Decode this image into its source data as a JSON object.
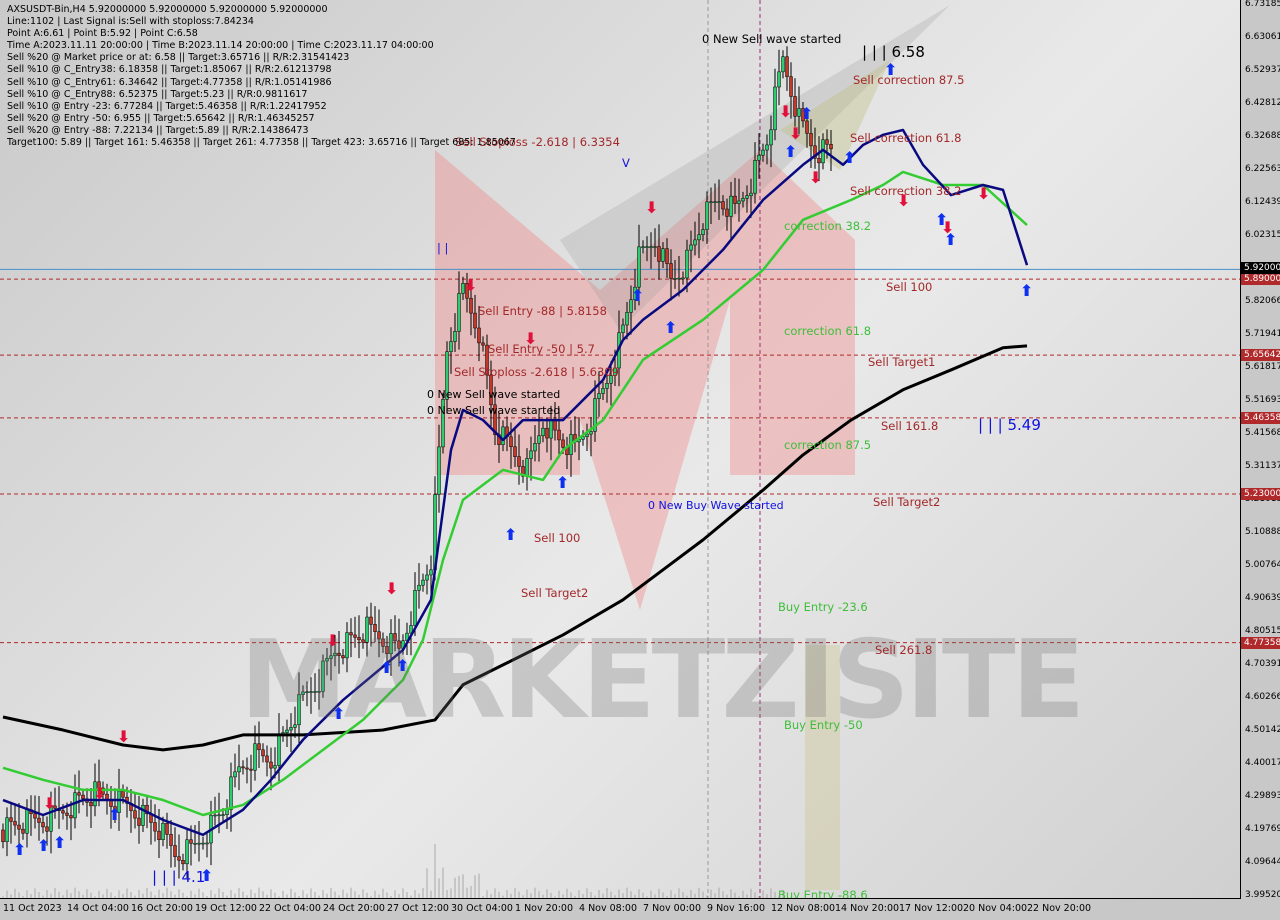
{
  "header": {
    "symbol_line": "AXSUSDT-Bin,H4  5.92000000 5.92000000 5.92000000 5.92000000",
    "lines": [
      "Line:1102 | Last Signal is:Sell with stoploss:7.84234",
      "Point A:6.61 | Point B:5.92 | Point C:6.58",
      "Time A:2023.11.11 20:00:00 | Time B:2023.11.14 20:00:00 | Time C:2023.11.17 04:00:00",
      "Sell %20 @ Market price or at: 6.58 || Target:3.65716 || R/R:2.31541423",
      "Sell %10 @ C_Entry38: 6.18358 || Target:1.85067 || R/R:2.61213798",
      "Sell %10 @ C_Entry61: 6.34642 || Target:4.77358 || R/R:1.05141986",
      "Sell %10 @ C_Entry88: 6.52375 || Target:5.23 || R/R:0.9811617",
      "Sell %10 @ Entry -23: 6.77284 || Target:5.46358 || R/R:1.22417952",
      "Sell %20 @ Entry -50: 6.955 || Target:5.65642 || R/R:1.46345257",
      "Sell %20 @ Entry -88: 7.22134 || Target:5.89 || R/R:2.14386473",
      "Target100: 5.89 || Target 161: 5.46358 || Target 261: 4.77358 || Target 423: 3.65716 || Target 685: 1.85067"
    ]
  },
  "watermark": "MARKETZISITE",
  "annotations": [
    "0 New Sell wave started",
    "| | | 6.58",
    "Sell correction 87.5",
    "Sell correction 61.8",
    "Sell correction 38.2",
    "correction 38.2",
    "Sell Stoploss -2.618 | 6.3354",
    "Sell Entry -88 | 5.8158",
    "Sell Entry -50 | 5.7",
    "Sell Stoploss -2.618 | 5.6309",
    "0 New Sell wave started",
    "0 New Sell wave started",
    "Sell 100",
    "correction 61.8",
    "Sell Target1",
    "Sell 161.8",
    "| | | 5.49",
    "correction 87.5",
    "0 New Buy Wave started",
    "Sell Target2",
    "Sell 100",
    "Sell Target2",
    "Buy Entry -23.6",
    "Sell 261.8",
    "Buy Entry -50",
    "| | | 4.1",
    "Buy Entry -88.6",
    "| |",
    "V"
  ],
  "chart_data": {
    "type": "candlestick",
    "timeframe": "H4",
    "ylim": [
      3.9952,
      6.73185
    ],
    "y_ticks": [
      "6.73185",
      "6.63061",
      "6.52937",
      "6.42812",
      "6.32688",
      "6.22563",
      "6.12439",
      "6.02315",
      "5.82066",
      "5.71941",
      "5.61817",
      "5.51693",
      "5.41568",
      "5.31137",
      "5.21013",
      "5.10888",
      "5.00764",
      "4.90639",
      "4.80515",
      "4.70391",
      "4.60266",
      "4.50142",
      "4.40017",
      "4.29893",
      "4.19769",
      "4.09644",
      "3.99520"
    ],
    "x_ticks": [
      "11 Oct 2023",
      "14 Oct 04:00",
      "16 Oct 20:00",
      "19 Oct 12:00",
      "22 Oct 04:00",
      "24 Oct 20:00",
      "27 Oct 12:00",
      "30 Oct 04:00",
      "1 Nov 20:00",
      "4 Nov 08:00",
      "7 Nov 00:00",
      "9 Nov 16:00",
      "12 Nov 08:00",
      "14 Nov 20:00",
      "17 Nov 12:00",
      "20 Nov 04:00",
      "22 Nov 20:00"
    ],
    "current_price": "5.92000",
    "levels": [
      {
        "label": "5.89000",
        "value": 5.89
      },
      {
        "label": "5.65642",
        "value": 5.65642
      },
      {
        "label": "5.46358",
        "value": 5.46358
      },
      {
        "label": "5.23000",
        "value": 5.23
      },
      {
        "label": "4.77358",
        "value": 4.77358
      }
    ],
    "closes_every_4_bars": [
      4.198,
      4.213,
      4.223,
      4.229,
      4.26,
      4.29,
      4.306,
      4.29,
      4.275,
      4.244,
      4.198,
      4.121,
      4.137,
      4.198,
      4.26,
      4.382,
      4.428,
      4.413,
      4.505,
      4.597,
      4.659,
      4.751,
      4.782,
      4.812,
      4.782,
      4.751,
      4.904,
      5.027,
      5.672,
      5.857,
      5.734,
      5.427,
      5.365,
      5.304,
      5.457,
      5.396,
      5.365,
      5.457,
      5.58,
      5.734,
      5.949,
      6.01,
      5.887,
      5.949,
      6.072,
      6.133,
      6.102,
      6.194,
      6.317,
      6.563,
      6.379,
      6.286,
      6.29
    ],
    "ma_slow": [
      [
        0,
        4.545
      ],
      [
        15,
        4.505
      ],
      [
        30,
        4.459
      ],
      [
        40,
        4.444
      ],
      [
        50,
        4.459
      ],
      [
        60,
        4.49
      ],
      [
        75,
        4.49
      ],
      [
        95,
        4.505
      ],
      [
        108,
        4.536
      ],
      [
        115,
        4.644
      ],
      [
        125,
        4.705
      ],
      [
        140,
        4.797
      ],
      [
        155,
        4.905
      ],
      [
        165,
        4.997
      ],
      [
        175,
        5.089
      ],
      [
        190,
        5.242
      ],
      [
        200,
        5.35
      ],
      [
        212,
        5.457
      ],
      [
        225,
        5.55
      ],
      [
        237,
        5.611
      ],
      [
        250,
        5.679
      ],
      [
        256,
        5.685
      ]
    ],
    "ma_mid": [
      [
        0,
        4.389
      ],
      [
        10,
        4.352
      ],
      [
        20,
        4.321
      ],
      [
        30,
        4.321
      ],
      [
        40,
        4.29
      ],
      [
        50,
        4.244
      ],
      [
        60,
        4.275
      ],
      [
        70,
        4.352
      ],
      [
        80,
        4.444
      ],
      [
        90,
        4.536
      ],
      [
        100,
        4.659
      ],
      [
        105,
        4.782
      ],
      [
        110,
        5.027
      ],
      [
        115,
        5.212
      ],
      [
        125,
        5.304
      ],
      [
        135,
        5.273
      ],
      [
        140,
        5.365
      ],
      [
        150,
        5.457
      ],
      [
        160,
        5.642
      ],
      [
        175,
        5.765
      ],
      [
        190,
        5.918
      ],
      [
        200,
        6.072
      ],
      [
        212,
        6.133
      ],
      [
        220,
        6.179
      ],
      [
        225,
        6.219
      ],
      [
        235,
        6.179
      ],
      [
        245,
        6.179
      ],
      [
        256,
        6.056
      ]
    ],
    "ma_fast": [
      [
        0,
        4.29
      ],
      [
        10,
        4.244
      ],
      [
        20,
        4.29
      ],
      [
        30,
        4.29
      ],
      [
        40,
        4.229
      ],
      [
        50,
        4.183
      ],
      [
        60,
        4.26
      ],
      [
        67,
        4.352
      ],
      [
        75,
        4.475
      ],
      [
        85,
        4.597
      ],
      [
        100,
        4.751
      ],
      [
        107,
        4.905
      ],
      [
        112,
        5.365
      ],
      [
        115,
        5.488
      ],
      [
        120,
        5.457
      ],
      [
        125,
        5.396
      ],
      [
        130,
        5.457
      ],
      [
        140,
        5.457
      ],
      [
        150,
        5.58
      ],
      [
        155,
        5.703
      ],
      [
        160,
        5.765
      ],
      [
        170,
        5.857
      ],
      [
        180,
        5.98
      ],
      [
        190,
        6.133
      ],
      [
        200,
        6.241
      ],
      [
        205,
        6.287
      ],
      [
        210,
        6.241
      ],
      [
        215,
        6.302
      ],
      [
        220,
        6.333
      ],
      [
        225,
        6.348
      ],
      [
        230,
        6.241
      ],
      [
        237,
        6.148
      ],
      [
        245,
        6.179
      ],
      [
        250,
        6.164
      ],
      [
        256,
        5.933
      ]
    ]
  },
  "colors": {
    "ma_slow": "#000000",
    "ma_mid": "#33cc33",
    "ma_fast": "#0a0a80",
    "bull": "#2ecc71",
    "bear": "#c0392b",
    "level": "#b0292b",
    "current": "#4a90c8"
  }
}
